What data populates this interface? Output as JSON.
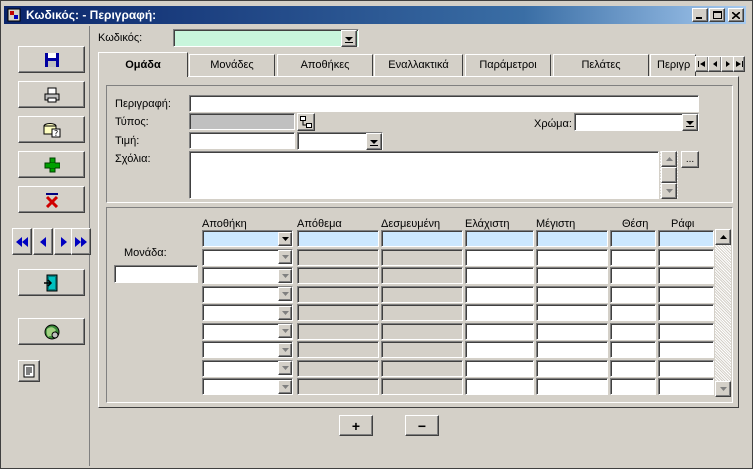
{
  "window": {
    "title": "Κωδικός:  - Περιγραφή:",
    "controls": [
      "minimize",
      "maximize",
      "close"
    ]
  },
  "toolbar": {
    "buttons": [
      {
        "name": "save",
        "icon": "floppy-disk-icon"
      },
      {
        "name": "print",
        "icon": "printer-icon"
      },
      {
        "name": "query",
        "icon": "query-help-icon"
      },
      {
        "name": "add",
        "icon": "plus-icon"
      },
      {
        "name": "delete",
        "icon": "red-x-icon"
      },
      {
        "name": "exit",
        "icon": "exit-door-icon"
      },
      {
        "name": "web",
        "icon": "globe-icon"
      },
      {
        "name": "notes",
        "icon": "document-icon"
      }
    ],
    "nav": [
      "first",
      "previous",
      "next",
      "last"
    ]
  },
  "header": {
    "code_label": "Κωδικός:",
    "code_value": ""
  },
  "tabs": {
    "items": [
      "Ομάδα",
      "Μονάδες",
      "Αποθήκες",
      "Εναλλακτικά",
      "Παράμετροι",
      "Πελάτες",
      "Περιγρ"
    ],
    "active_index": 0
  },
  "form": {
    "description_label": "Περιγραφή:",
    "description_value": "",
    "type_label": "Τύπος:",
    "type_value": "",
    "color_label": "Χρώμα:",
    "color_value": "",
    "price_label": "Τιμή:",
    "price_value": "",
    "price_unit_value": "",
    "comments_label": "Σχόλια:",
    "comments_value": "",
    "ellipsis_label": "..."
  },
  "stock_grid": {
    "unit_label": "Μονάδα:",
    "unit_value": "",
    "columns": [
      "Αποθήκη",
      "Απόθεμα",
      "Δεσμευμένη",
      "Ελάχιστη",
      "Μέγιστη",
      "Θέση",
      "Ράφι"
    ],
    "row_count": 9,
    "selected_row": 0
  },
  "actions": {
    "add_row": "+",
    "remove_row": "−"
  },
  "colors": {
    "code_field_bg": "#c8f5dc",
    "selected_row_bg": "#cce8ff",
    "face": "#d4d0c8",
    "titlebar_start": "#0a246a"
  }
}
